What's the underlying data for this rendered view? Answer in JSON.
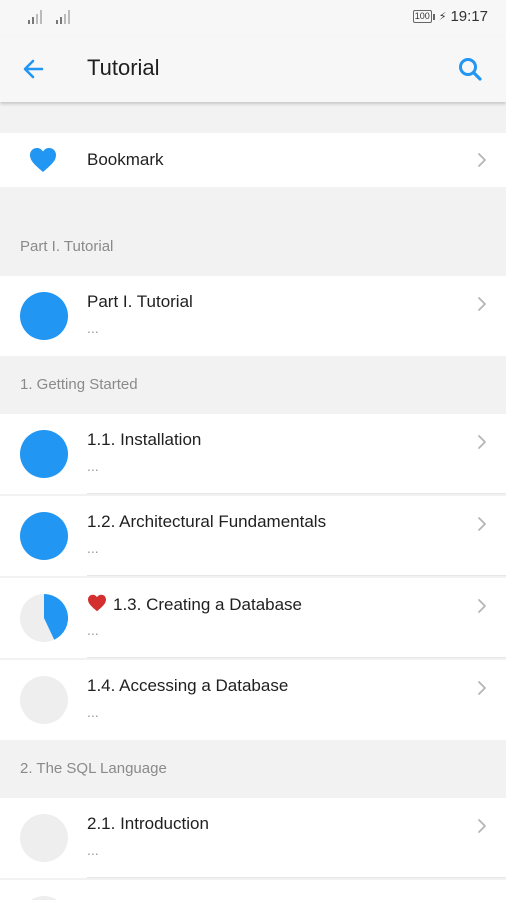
{
  "status_bar": {
    "battery": "100",
    "time": "19:17"
  },
  "app_bar": {
    "title": "Tutorial",
    "back_icon": "arrow-left-icon",
    "search_icon": "search-icon"
  },
  "bookmark": {
    "label": "Bookmark",
    "icon": "heart-icon"
  },
  "sections": [
    {
      "header": "Part I. Tutorial",
      "items": [
        {
          "title": "Part I. Tutorial",
          "subtitle": "...",
          "progress": 1.0,
          "bookmarked": false
        }
      ]
    },
    {
      "header": "1. Getting Started",
      "items": [
        {
          "title": "1.1. Installation",
          "subtitle": "...",
          "progress": 1.0,
          "bookmarked": false
        },
        {
          "title": "1.2. Architectural Fundamentals",
          "subtitle": "...",
          "progress": 1.0,
          "bookmarked": false
        },
        {
          "title": "1.3. Creating a Database",
          "subtitle": "...",
          "progress": 0.43,
          "bookmarked": true
        },
        {
          "title": "1.4. Accessing a Database",
          "subtitle": "...",
          "progress": 0.0,
          "bookmarked": false
        }
      ]
    },
    {
      "header": "2. The SQL Language",
      "items": [
        {
          "title": "2.1. Introduction",
          "subtitle": "...",
          "progress": 0.0,
          "bookmarked": false
        }
      ]
    }
  ],
  "colors": {
    "accent": "#2196f3",
    "bookmark_heart": "#d32f2f",
    "progress_track": "#eeeeee",
    "section_text": "#8a8a8a"
  }
}
